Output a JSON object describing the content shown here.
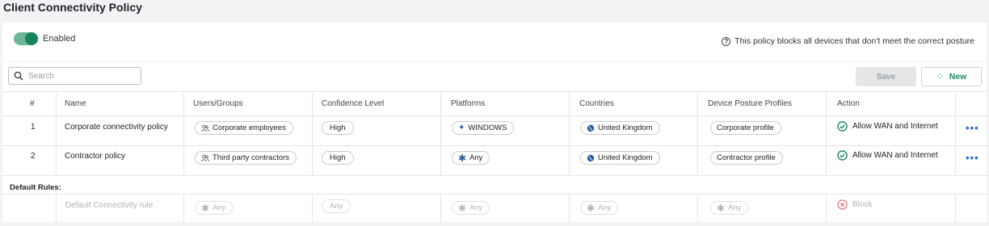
{
  "page_title": "Client Connectivity Policy",
  "status": {
    "enabled_label": "Enabled",
    "posture_note": "This policy blocks all devices that don't meet the correct posture"
  },
  "toolbar": {
    "search_placeholder": "Search",
    "save_label": "Save",
    "new_label": "New"
  },
  "columns": [
    "#",
    "Name",
    "Users/Groups",
    "Confidence Level",
    "Platforms",
    "Countries",
    "Device Posture Profiles",
    "Action"
  ],
  "rows": [
    {
      "num": "1",
      "name": "Corporate connectivity policy",
      "users": "Corporate employees",
      "confidence": "High",
      "platform": "WINDOWS",
      "country": "United Kingdom",
      "profile": "Corporate profile",
      "action": "Allow WAN and Internet"
    },
    {
      "num": "2",
      "name": "Contractor policy",
      "users": "Third party contractors",
      "confidence": "High",
      "platform": "Any",
      "country": "United Kingdom",
      "profile": "Contractor profile",
      "action": "Allow WAN and Internet"
    }
  ],
  "default_rules": {
    "label": "Default Rules:",
    "name": "Default Connectivity rule",
    "users": "Any",
    "confidence": "Any",
    "platform": "Any",
    "country": "Any",
    "profile": "Any",
    "action": "Block"
  },
  "colors": {
    "accent_green": "#16865a",
    "more_blue": "#2d6fc7",
    "block_red": "#e57373"
  },
  "icons": [
    "help-circle-icon",
    "search-icon",
    "add-icon",
    "users-icon",
    "windows-icon",
    "asterisk-icon",
    "globe-icon",
    "check-circle-icon",
    "block-icon",
    "more-icon"
  ]
}
